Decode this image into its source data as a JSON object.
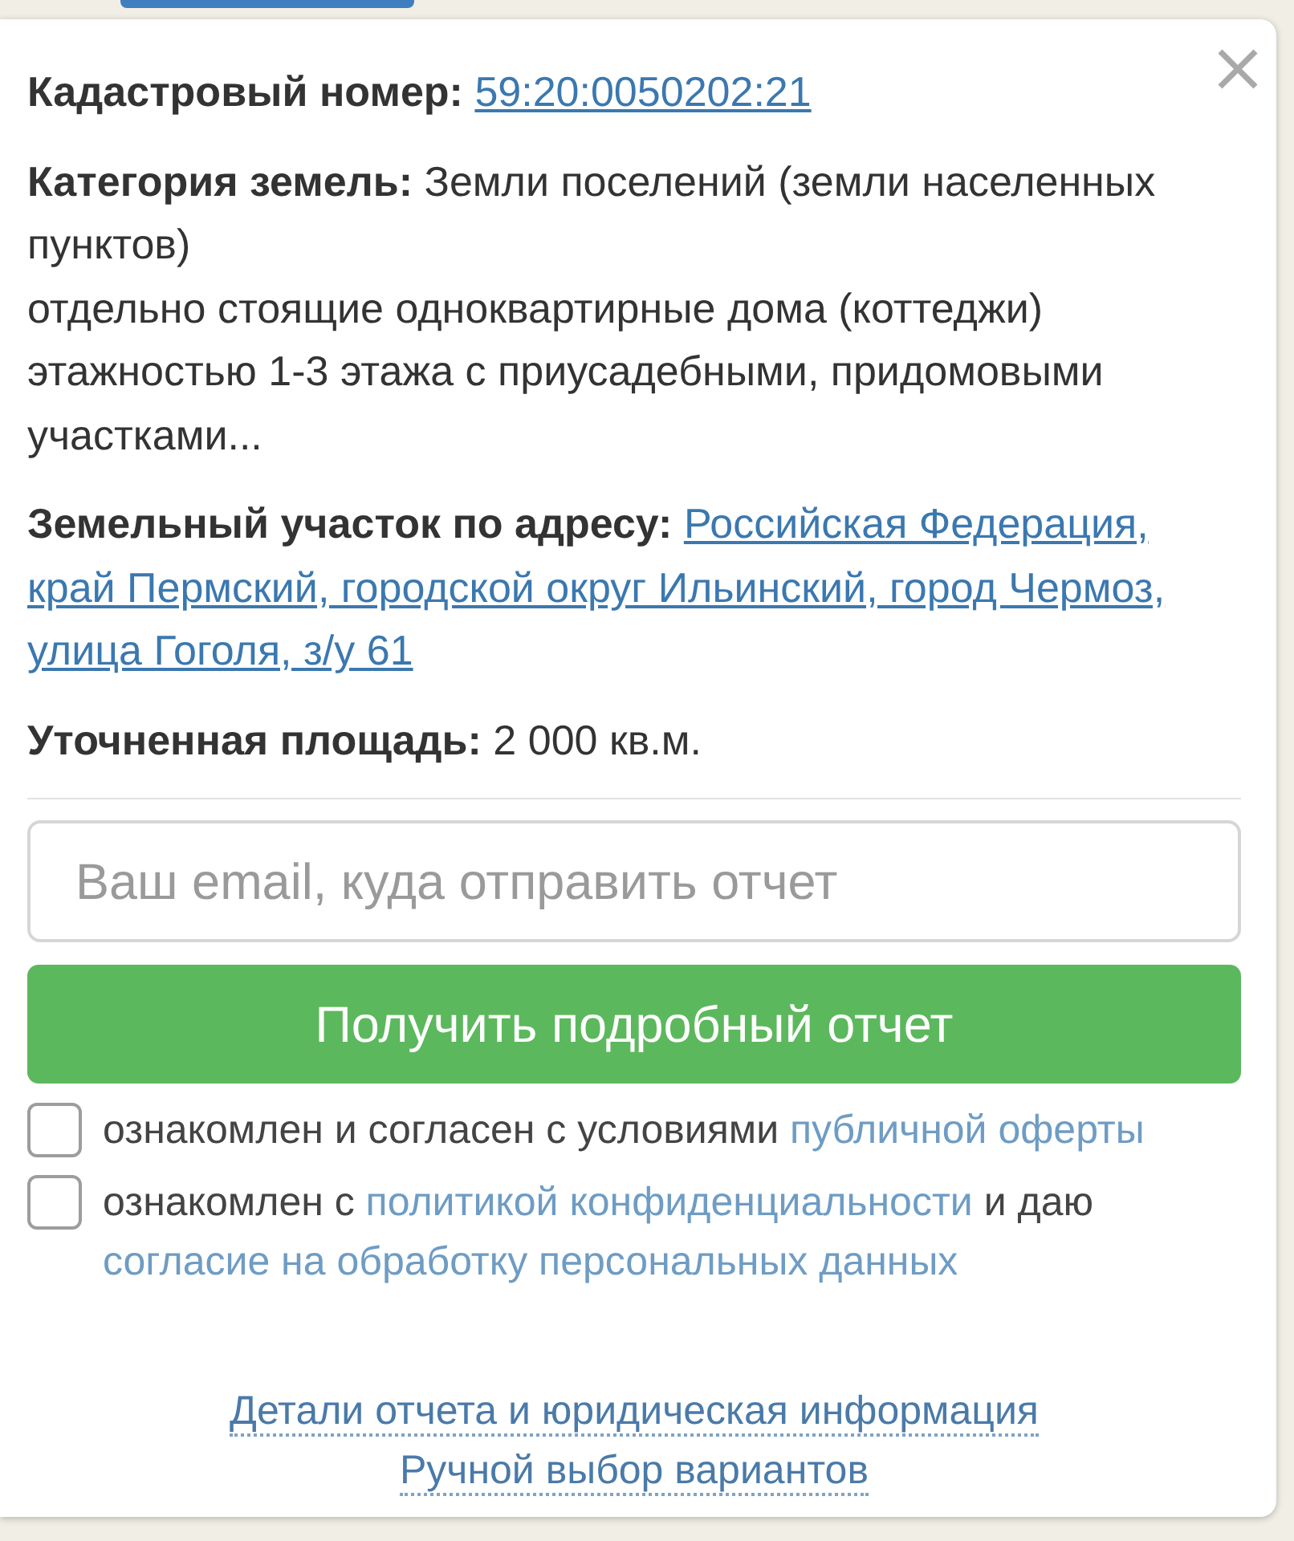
{
  "popup": {
    "fields": [
      {
        "kind": "link",
        "label": "Кадастровый номер:",
        "value": "59:20:0050202:21"
      },
      {
        "kind": "text",
        "label": "Категория земель:",
        "value": "Земли поселений (земли населенных пунктов)",
        "note": "отдельно стоящие одноквартирные дома (коттеджи) этажностью 1-3 этажа с приусадебными, придомовыми участками..."
      },
      {
        "kind": "address",
        "label": "Земельный участок по адресу:",
        "value": "Российская Федерация, край Пермский, городской округ Ильинский, город Чермоз, улица Гоголя, з/у 61"
      },
      {
        "kind": "text",
        "label": "Уточненная площадь:",
        "value": "2 000 кв.м."
      }
    ],
    "email_field": {
      "placeholder": "Ваш email, куда отправить отчет"
    },
    "submit_button": "Получить подробный отчет",
    "consents": [
      {
        "checked": false,
        "parts": [
          {
            "kind": "text",
            "text": "ознакомлен и согласен с условиями "
          },
          {
            "kind": "link",
            "text": "публичной оферты"
          }
        ]
      },
      {
        "checked": false,
        "parts": [
          {
            "kind": "text",
            "text": "ознакомлен с "
          },
          {
            "kind": "link",
            "text": "политикой конфиденциальности"
          },
          {
            "kind": "text",
            "text": " и даю "
          },
          {
            "kind": "link",
            "text": "согласие на обработку персональных данных"
          }
        ]
      }
    ],
    "footer_links": [
      "Детали отчета и юридическая информация",
      "Ручной выбор вариантов"
    ]
  }
}
